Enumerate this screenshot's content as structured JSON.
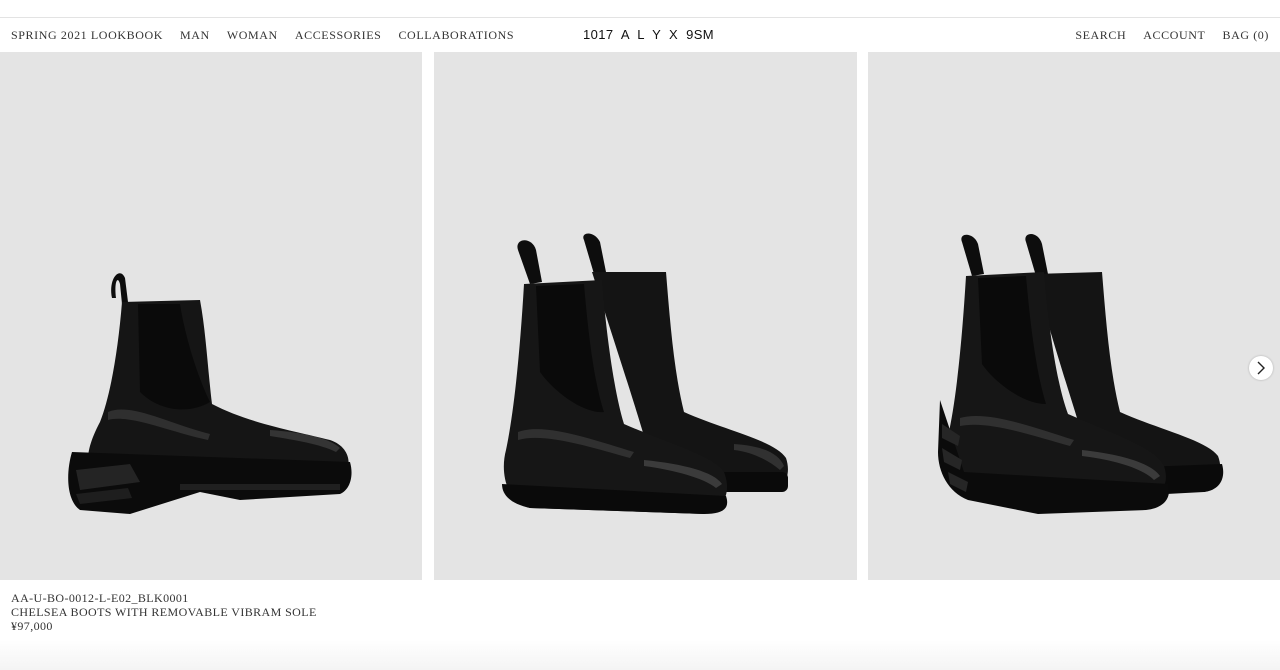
{
  "nav": {
    "left": [
      "SPRING 2021 LOOKBOOK",
      "MAN",
      "WOMAN",
      "ACCESSORIES",
      "COLLABORATIONS"
    ],
    "brand": "1017  A  L  Y  X  9SM",
    "right": {
      "search": "SEARCH",
      "account": "ACCOUNT",
      "bag": "BAG (0)"
    }
  },
  "gallery": {
    "images": [
      {
        "alt": "single chelsea boot side view",
        "icon": "boot-side-image"
      },
      {
        "alt": "pair of chelsea boots front view without sole",
        "icon": "boot-pair-image"
      },
      {
        "alt": "pair of chelsea boots with vibram sole",
        "icon": "boot-pair-sole-image"
      }
    ],
    "next_icon": "chevron-right-icon",
    "background": "#e4e4e4"
  },
  "product": {
    "sku": "AA-U-BO-0012-L-E02_BLK0001",
    "name": "CHELSEA BOOTS WITH REMOVABLE VIBRAM SOLE",
    "price": "¥97,000"
  }
}
